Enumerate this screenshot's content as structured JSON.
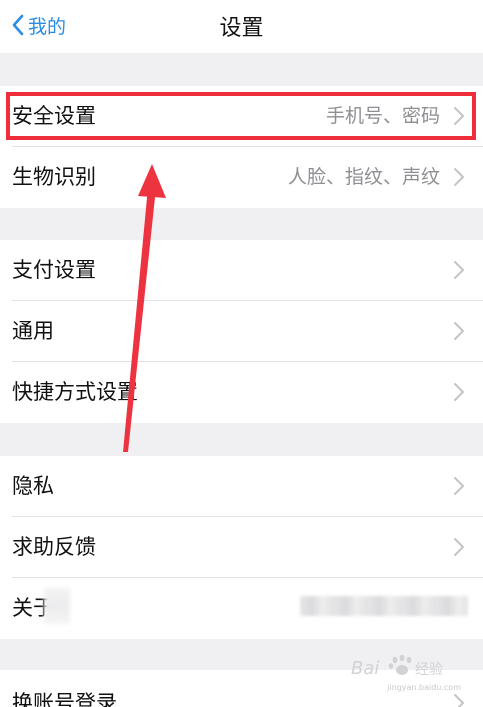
{
  "navbar": {
    "back_label": "我的",
    "title": "设置"
  },
  "group1": {
    "items": [
      {
        "label": "安全设置",
        "value": "手机号、密码"
      },
      {
        "label": "生物识别",
        "value": "人脸、指纹、声纹"
      }
    ]
  },
  "group2": {
    "items": [
      {
        "label": "支付设置"
      },
      {
        "label": "通用"
      },
      {
        "label": "快捷方式设置"
      }
    ]
  },
  "group3": {
    "items": [
      {
        "label": "隐私"
      },
      {
        "label": "求助反馈"
      },
      {
        "label": "关于"
      }
    ]
  },
  "group4": {
    "items": [
      {
        "label": "换账号登录"
      }
    ]
  },
  "annotation": {
    "highlight_color": "#ee2f3b",
    "arrow_color": "#ee3340"
  },
  "watermark": {
    "text": "jingyan.baidu.com",
    "logo_icon": "baidu-jingyan-logo-icon"
  },
  "theme": {
    "accent": "#2b8ce6",
    "background": "#f0f0f2",
    "text": "#111111",
    "secondary_text": "#8e8e93"
  }
}
